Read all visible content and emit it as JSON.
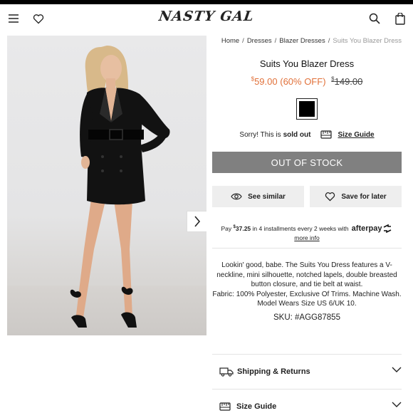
{
  "header": {
    "logo": "NASTY GAL",
    "icons": [
      "menu-icon",
      "heart-icon",
      "search-icon",
      "bag-icon"
    ]
  },
  "breadcrumb": {
    "home": "Home",
    "dresses": "Dresses",
    "blazer_dresses": "Blazer Dresses",
    "current": "Suits You Blazer Dress",
    "separator": "/"
  },
  "product": {
    "title": "Suits You Blazer Dress",
    "price_symbol": "$",
    "price_value": "59.00",
    "discount": "(60% OFF)",
    "was_symbol": "$",
    "was_value": "149.00",
    "color": "#000000",
    "availability_prefix": "Sorry! This is",
    "availability_status": "sold out",
    "size_guide_label": "Size Guide",
    "out_of_stock_label": "OUT OF STOCK",
    "see_similar_label": "See similar",
    "save_later_label": "Save for later"
  },
  "afterpay": {
    "pay_label": "Pay",
    "amount_symbol": "$",
    "amount_value": "37.25",
    "rest": "in 4 installments every 2 weeks with",
    "brand": "afterpay",
    "more_info": "more info"
  },
  "description": {
    "text": "Lookin' good, babe. The Suits You Dress features a V-neckline, mini silhouette, notched lapels, double breasted button closure, and tie belt at waist.",
    "fabric": "Fabric: 100% Polyester, Exclusive Of Trims. Machine Wash.",
    "model": "Model Wears Size US 6/UK 10.",
    "sku": "SKU: #AGG87855"
  },
  "accordion": {
    "shipping_label": "Shipping & Returns",
    "size_guide_label": "Size Guide"
  },
  "colors": {
    "accent_sale": "#e1713a",
    "oos_button": "#808080",
    "secondary_button": "#eeeeee"
  }
}
